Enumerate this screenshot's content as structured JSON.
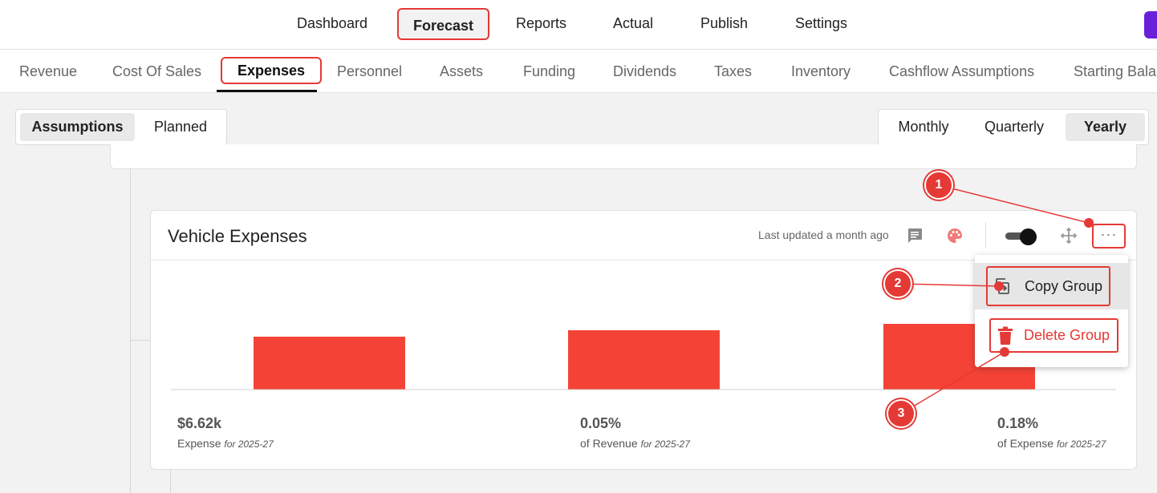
{
  "top_nav": {
    "items": [
      "Dashboard",
      "Forecast",
      "Reports",
      "Actual",
      "Publish",
      "Settings"
    ],
    "active": "Forecast"
  },
  "sub_nav": {
    "items": [
      "Revenue",
      "Cost Of Sales",
      "Expenses",
      "Personnel",
      "Assets",
      "Funding",
      "Dividends",
      "Taxes",
      "Inventory",
      "Cashflow Assumptions",
      "Starting Balar"
    ],
    "active": "Expenses"
  },
  "view_toggle": {
    "options": [
      "Assumptions",
      "Planned"
    ],
    "selected": "Assumptions"
  },
  "period_toggle": {
    "options": [
      "Monthly",
      "Quarterly",
      "Yearly"
    ],
    "selected": "Yearly"
  },
  "card": {
    "title": "Vehicle Expenses",
    "last_updated": "Last updated a month ago",
    "more_label": "···"
  },
  "chart_data": {
    "type": "bar",
    "values": [
      66,
      74,
      82
    ],
    "color": "#f44336",
    "stats": [
      {
        "value": "$6.62k",
        "label": "Expense",
        "period": "for 2025-27"
      },
      {
        "value": "0.05%",
        "label": "of Revenue",
        "period": "for 2025-27"
      },
      {
        "value": "0.18%",
        "label": "of Expense",
        "period": "for 2025-27"
      }
    ]
  },
  "menu": {
    "copy_label": "Copy Group",
    "delete_label": "Delete Group"
  },
  "callouts": [
    "1",
    "2",
    "3"
  ],
  "colors": {
    "accent": "#e53935",
    "bar": "#f44336",
    "toggle_chip": "#6a1fd8"
  }
}
